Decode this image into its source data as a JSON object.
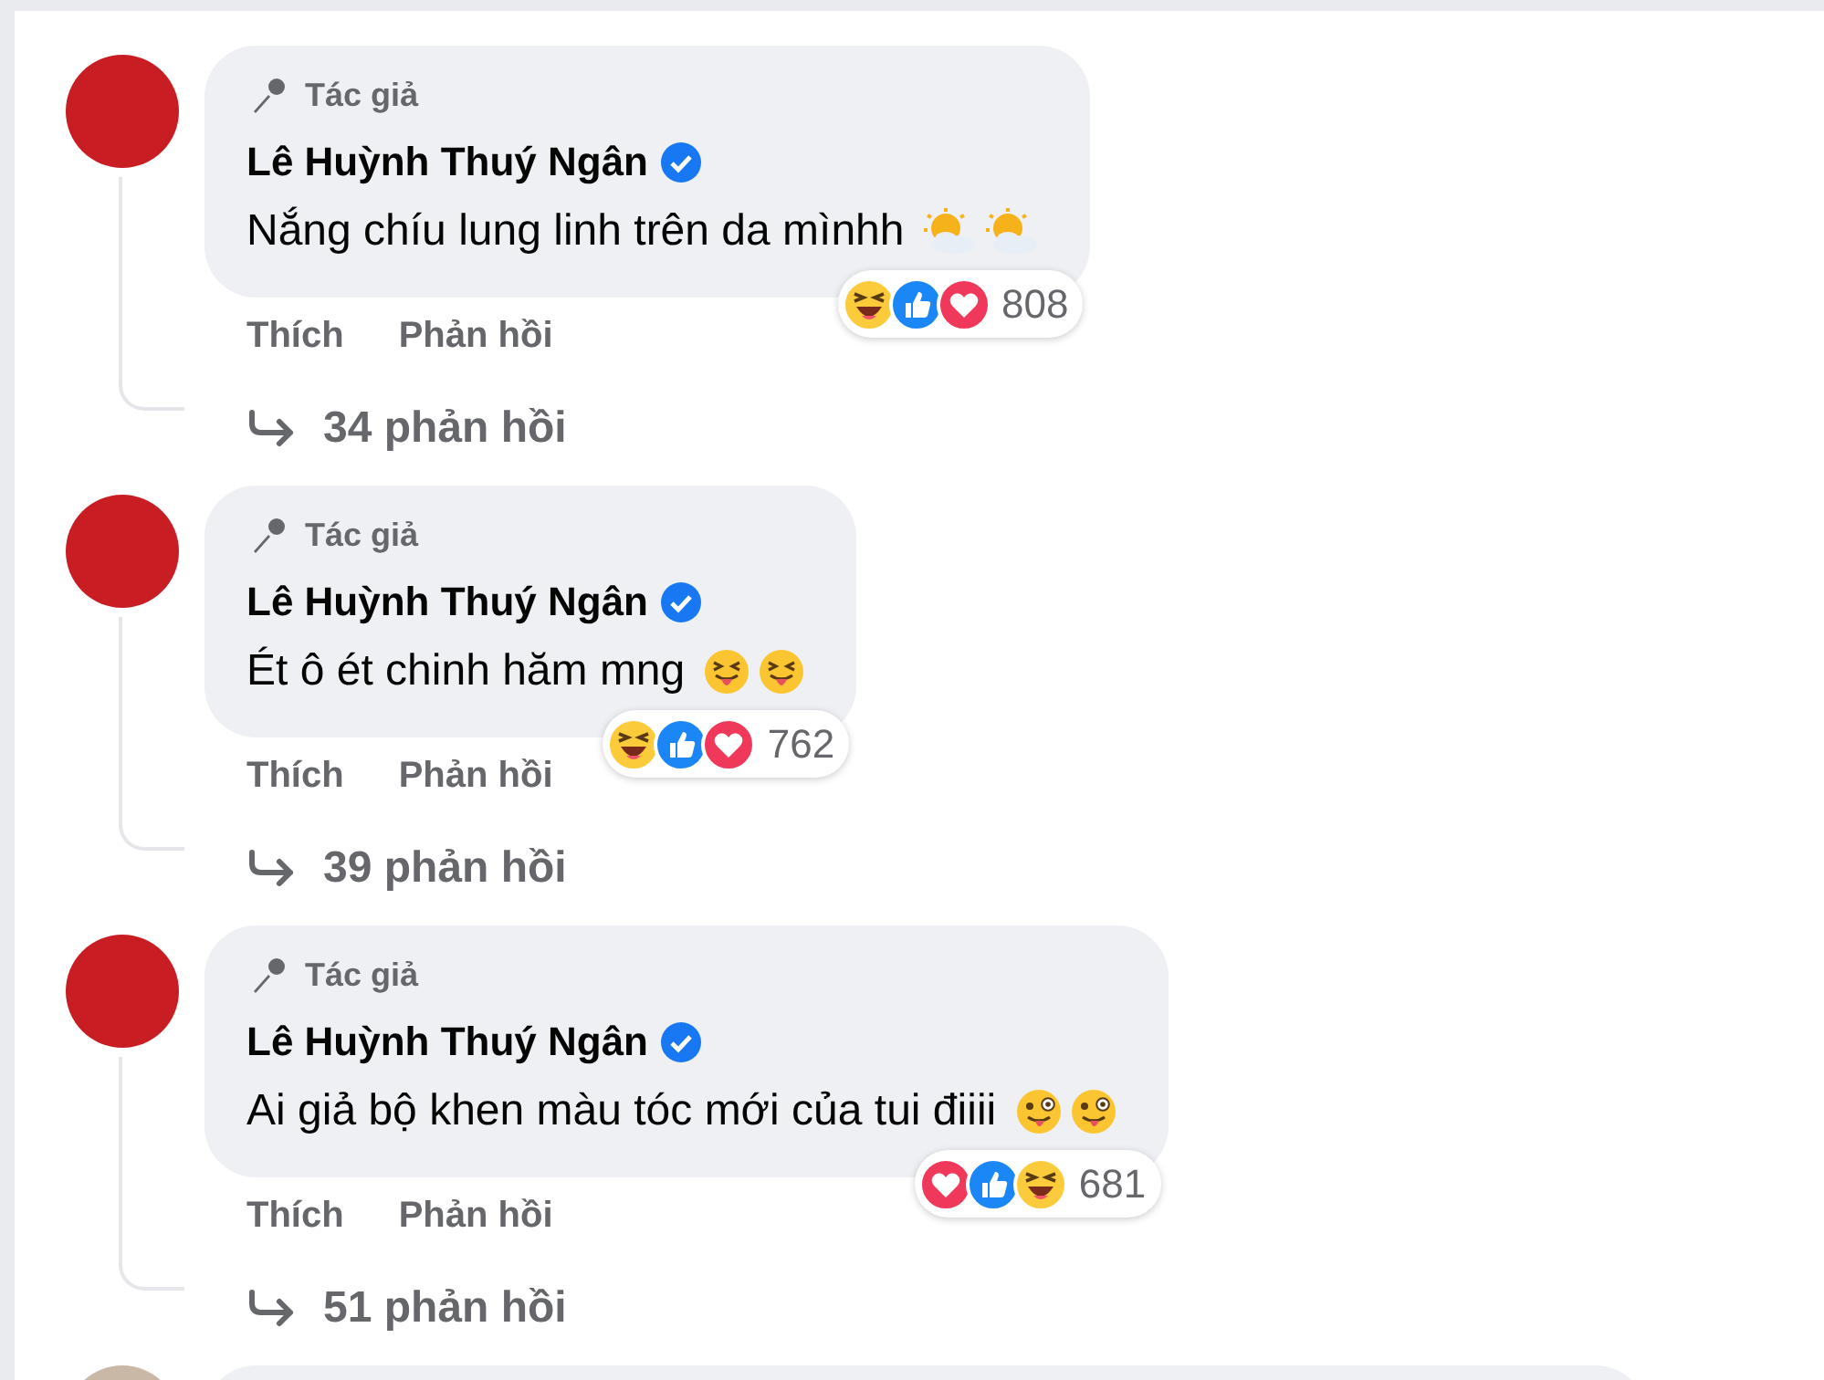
{
  "comments": [
    {
      "badge": "Tác giả",
      "author": "Lê Huỳnh Thuý Ngân",
      "verified": true,
      "text": "Nắng chíu lung linh trên da mìnhh",
      "text_emojis": [
        {
          "kind": "sun_cloud"
        },
        {
          "kind": "sun_cloud"
        }
      ],
      "reactions": [
        {
          "kind": "haha"
        },
        {
          "kind": "like"
        },
        {
          "kind": "love"
        }
      ],
      "reaction_count": "808",
      "actions": [
        "Thích",
        "Phản hồi"
      ],
      "replies": "34 phản hồi"
    },
    {
      "badge": "Tác giả",
      "author": "Lê Huỳnh Thuý Ngân",
      "verified": true,
      "text": "Ét ô ét chinh hăm mng",
      "text_emojis": [
        {
          "kind": "squint_tongue"
        },
        {
          "kind": "squint_tongue"
        }
      ],
      "reactions": [
        {
          "kind": "haha"
        },
        {
          "kind": "like"
        },
        {
          "kind": "love"
        }
      ],
      "reaction_count": "762",
      "actions": [
        "Thích",
        "Phản hồi"
      ],
      "replies": "39 phản hồi"
    },
    {
      "badge": "Tác giả",
      "author": "Lê Huỳnh Thuý Ngân",
      "verified": true,
      "text": "Ai giả bộ khen màu tóc mới của tui điiii",
      "text_emojis": [
        {
          "kind": "zany"
        },
        {
          "kind": "zany"
        }
      ],
      "reactions": [
        {
          "kind": "love"
        },
        {
          "kind": "like"
        },
        {
          "kind": "haha"
        }
      ],
      "reaction_count": "681",
      "actions": [
        "Thích",
        "Phản hồi"
      ],
      "replies": "51 phản hồi"
    }
  ]
}
